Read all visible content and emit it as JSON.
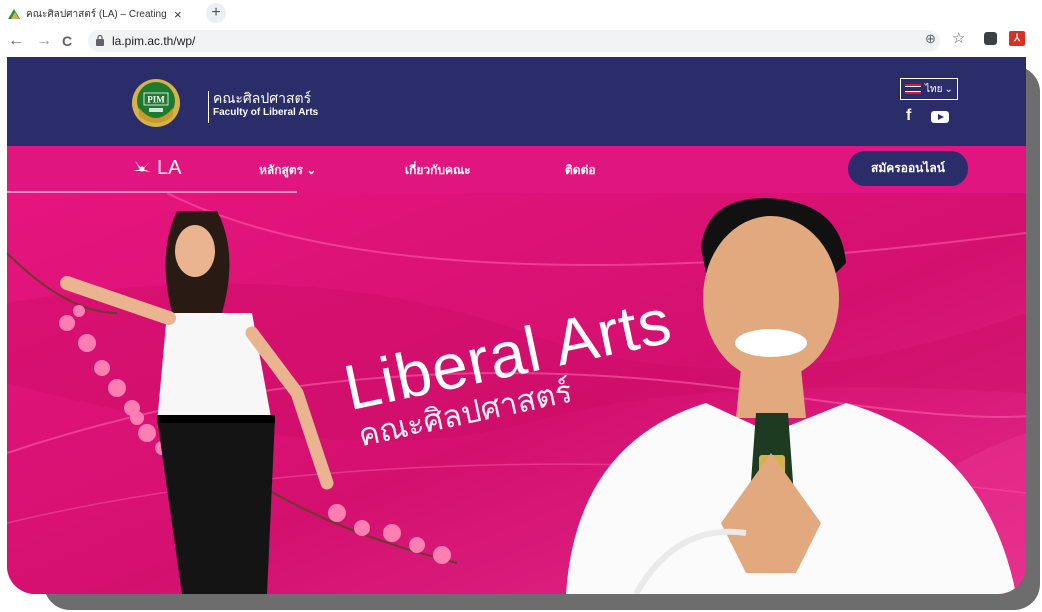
{
  "browser": {
    "tab_title": "คณะศิลปศาสตร์ (LA) – Creating Pro",
    "tab_close": "×",
    "new_tab": "+",
    "url": "la.pim.ac.th/wp/",
    "back_icon": "←",
    "forward_icon": "→",
    "reload_icon": "C",
    "zoom_icon": "⊕",
    "bookmark_icon": "☆"
  },
  "header": {
    "faculty_th": "คณะศิลปศาสตร์",
    "faculty_en": "Faculty of Liberal Arts",
    "language": "ไทย",
    "language_caret": "⌄",
    "facebook": "f"
  },
  "nav": {
    "brand": "LA",
    "items": [
      {
        "label": "หลักสูตร ⌄"
      },
      {
        "label": "เกี่ยวกับคณะ"
      },
      {
        "label": "ติดต่อ"
      }
    ],
    "apply_button": "สมัครออนไลน์"
  },
  "hero": {
    "title": "Liberal Arts",
    "subtitle": "คณะศิลปศาสตร์"
  },
  "colors": {
    "navy": "#2b2d6b",
    "magenta": "#e0157f",
    "pim_green": "#1f7a2f",
    "pim_gold": "#d6b24a"
  }
}
